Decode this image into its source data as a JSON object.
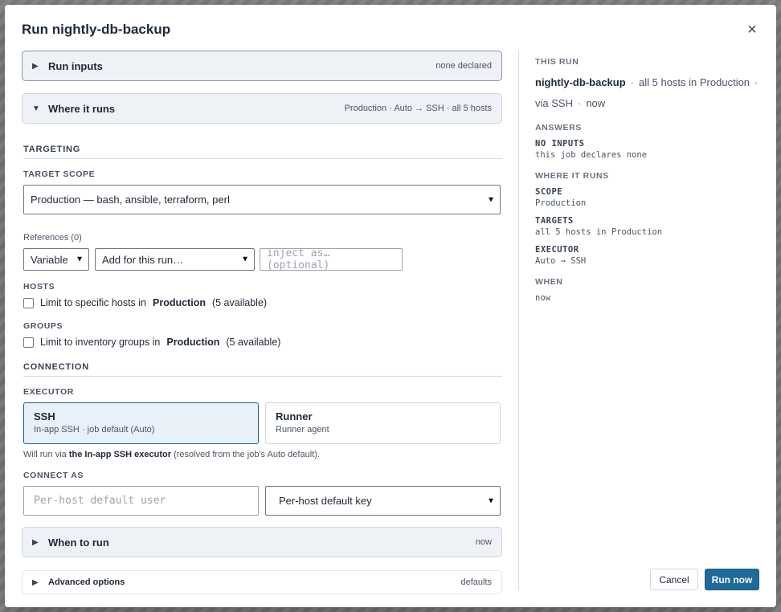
{
  "modal": {
    "title": "Run nightly-db-backup",
    "close_icon": "×"
  },
  "accordions": {
    "run_inputs": {
      "title": "Run inputs",
      "summary": "none declared",
      "caret": "▶"
    },
    "where_it_runs": {
      "title": "Where it runs",
      "summary": "Production · Auto → SSH · all 5 hosts",
      "caret": "▼"
    },
    "when_to_run": {
      "title": "When to run",
      "summary": "now",
      "caret": "▶"
    },
    "advanced": {
      "title": "Advanced options",
      "summary": "defaults",
      "caret": "▶"
    }
  },
  "targeting": {
    "heading": "TARGETING",
    "scope_label": "TARGET SCOPE",
    "scope_value": "Production — bash, ansible, terraform, perl",
    "references_label": "References (0)",
    "ref_type": "Variable",
    "ref_add": "Add for this run…",
    "ref_inject_placeholder": "inject as… (optional)",
    "hosts_label": "HOSTS",
    "hosts_text": "Limit to specific hosts in",
    "hosts_env": "Production",
    "hosts_count": "(5 available)",
    "groups_label": "GROUPS",
    "groups_text": "Limit to inventory groups in",
    "groups_env": "Production",
    "groups_count": "(5 available)"
  },
  "connection": {
    "heading": "CONNECTION",
    "executor_label": "EXECUTOR",
    "executors": [
      {
        "name": "SSH",
        "desc": "In-app SSH · job default (Auto)"
      },
      {
        "name": "Runner",
        "desc": "Runner agent"
      }
    ],
    "note_prefix": "Will run via",
    "note_bold": "the In-app SSH executor",
    "note_suffix": "(resolved from the job's Auto default).",
    "connect_as_label": "CONNECT AS",
    "user_placeholder": "Per-host default user",
    "key_value": "Per-host default key"
  },
  "summary": {
    "heading": "THIS RUN",
    "job": "nightly-db-backup",
    "hosts": "all 5 hosts in Production",
    "via": "via SSH",
    "when": "now",
    "answers_label": "ANSWERS",
    "no_inputs_key": "NO INPUTS",
    "no_inputs_val": "this job declares none",
    "where_label": "WHERE IT RUNS",
    "scope_key": "SCOPE",
    "scope_val": "Production",
    "targets_key": "TARGETS",
    "targets_val": "all 5 hosts in Production",
    "executor_key": "EXECUTOR",
    "executor_val": "Auto → SSH",
    "when_label": "WHEN",
    "when_val": "now"
  },
  "buttons": {
    "cancel": "Cancel",
    "run": "Run now"
  }
}
